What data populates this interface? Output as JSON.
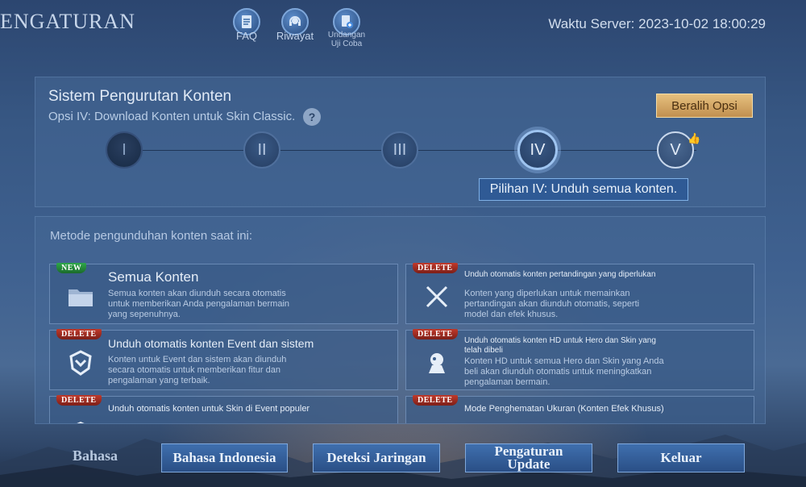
{
  "header": {
    "title": "ENGATURAN",
    "server_time": "Waktu Server: 2023-10-02 18:00:29",
    "nav": [
      {
        "label": "FAQ",
        "icon": "faq-icon"
      },
      {
        "label": "Riwayat",
        "icon": "headset-icon"
      },
      {
        "label": "Undangan Uji Coba",
        "icon": "invite-icon"
      }
    ]
  },
  "system": {
    "title": "Sistem Pengurutan Konten",
    "subtitle": "Opsi IV: Download Konten untuk Skin Classic.",
    "help": "?",
    "switch_label": "Beralih Opsi",
    "steps": [
      "I",
      "II",
      "III",
      "IV",
      "V"
    ],
    "selected_step": "IV",
    "tip": "Pilihan IV: Unduh semua konten."
  },
  "methods": {
    "title": "Metode pengunduhan konten saat ini:",
    "cards": [
      {
        "badge": "NEW",
        "title": "Semua Konten",
        "desc": "Semua konten akan diunduh secara otomatis untuk memberikan Anda pengalaman bermain yang sepenuhnya.",
        "icon": "folder-icon"
      },
      {
        "badge": "DELETE",
        "title": "Unduh otomatis konten pertandingan yang diperlukan",
        "desc": "Konten yang diperlukan untuk memainkan pertandingan akan diunduh otomatis, seperti model dan efek khusus.",
        "icon": "swords-icon"
      },
      {
        "badge": "DELETE",
        "title": "Unduh otomatis konten Event dan sistem",
        "desc": "Konten untuk Event dan sistem akan diunduh secara otomatis untuk memberikan fitur dan pengalaman yang terbaik.",
        "icon": "emblem-icon"
      },
      {
        "badge": "DELETE",
        "title": "Unduh otomatis konten HD untuk Hero dan Skin yang telah dibeli",
        "desc": "Konten HD untuk semua Hero dan Skin yang Anda beli akan diunduh otomatis untuk meningkatkan pengalaman bermain.",
        "icon": "hero-icon"
      },
      {
        "badge": "DELETE",
        "title": "Unduh otomatis konten untuk Skin di Event populer",
        "desc": "",
        "icon": "skin-icon"
      },
      {
        "badge": "DELETE",
        "title": "Mode Penghematan Ukuran (Konten Efek Khusus)",
        "desc": "",
        "icon": "package-icon"
      }
    ]
  },
  "footer": {
    "label": "Bahasa",
    "buttons": [
      "Bahasa Indonesia",
      "Deteksi Jaringan",
      "Pengaturan Update",
      "Keluar"
    ]
  }
}
